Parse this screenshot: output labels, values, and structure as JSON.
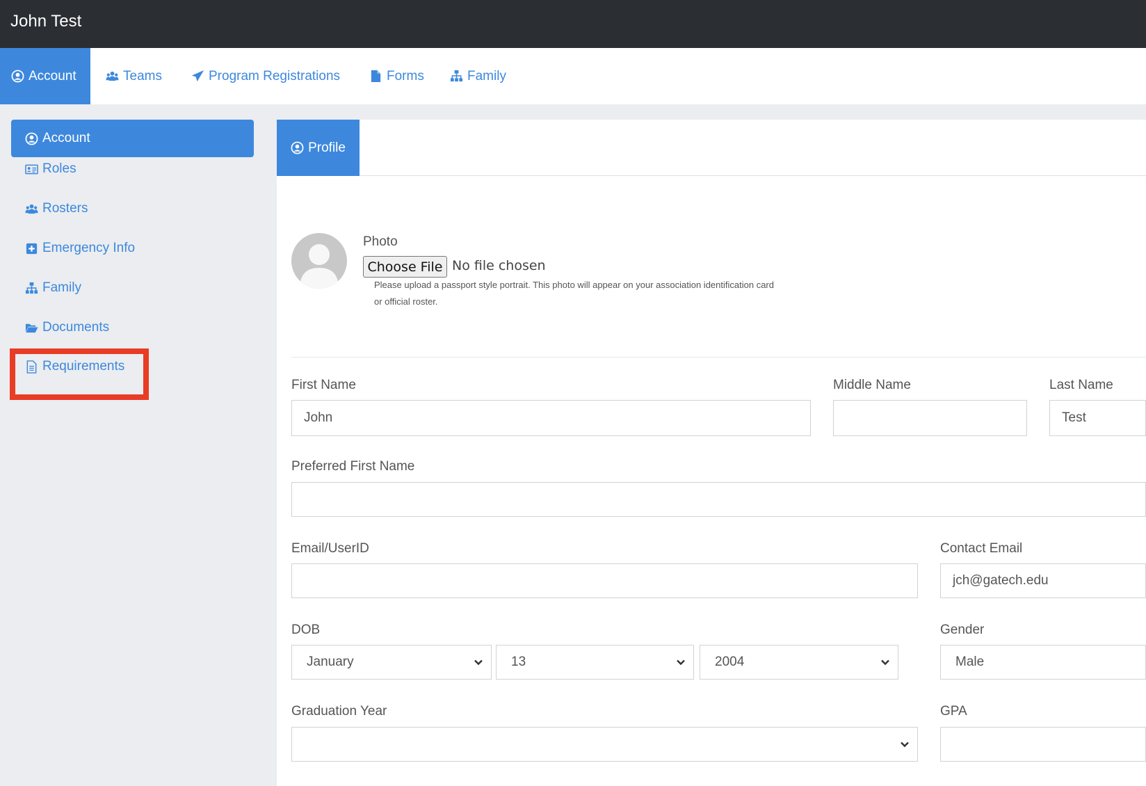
{
  "header": {
    "title": "John Test"
  },
  "nav": {
    "tabs": [
      {
        "label": "Account",
        "icon": "user-circle-icon"
      },
      {
        "label": "Teams",
        "icon": "users-icon"
      },
      {
        "label": "Program Registrations",
        "icon": "paper-plane-icon"
      },
      {
        "label": "Forms",
        "icon": "file-icon"
      },
      {
        "label": "Family",
        "icon": "sitemap-icon"
      }
    ]
  },
  "sidebar": {
    "items": [
      {
        "label": "Account",
        "icon": "user-circle-icon"
      },
      {
        "label": "Roles",
        "icon": "id-card-icon"
      },
      {
        "label": "Rosters",
        "icon": "users-icon"
      },
      {
        "label": "Emergency Info",
        "icon": "plus-square-icon"
      },
      {
        "label": "Family",
        "icon": "sitemap-icon"
      },
      {
        "label": "Documents",
        "icon": "folder-open-icon"
      },
      {
        "label": "Requirements",
        "icon": "file-text-icon"
      }
    ]
  },
  "profile": {
    "tab_label": "Profile",
    "photo": {
      "label": "Photo",
      "button": "Choose File",
      "status": "No file chosen",
      "help_line1": "Please upload a passport style portrait. This photo will appear on your association identification card",
      "help_line2": "or official roster."
    },
    "fields": {
      "first_name": {
        "label": "First Name",
        "value": "John"
      },
      "middle_name": {
        "label": "Middle Name",
        "value": ""
      },
      "last_name": {
        "label": "Last Name",
        "value": "Test"
      },
      "preferred_first_name": {
        "label": "Preferred First Name",
        "value": ""
      },
      "email_userid": {
        "label": "Email/UserID",
        "value": ""
      },
      "contact_email": {
        "label": "Contact Email",
        "value": "jch@gatech.edu"
      },
      "dob": {
        "label": "DOB",
        "month": "January",
        "day": "13",
        "year": "2004"
      },
      "gender": {
        "label": "Gender",
        "value": "Male"
      },
      "graduation_year": {
        "label": "Graduation Year",
        "value": ""
      },
      "gpa": {
        "label": "GPA",
        "value": ""
      }
    }
  },
  "colors": {
    "brand": "#3d88dd",
    "header_bg": "#2b2e32",
    "highlight": "#e83c25"
  }
}
